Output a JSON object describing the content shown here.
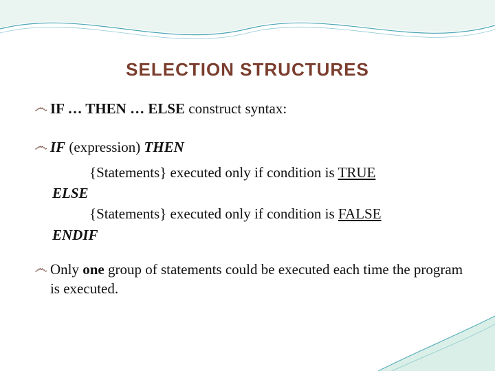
{
  "title": "SELECTION STRUCTURES",
  "line1": {
    "pre": "IF … THEN … ELSE",
    "rest": " construct syntax:"
  },
  "code": {
    "l1_a": "IF",
    "l1_b": " (expression) ",
    "l1_c": "THEN",
    "l2_a": "{Statements}  executed only if condition is ",
    "l2_true": "TRUE",
    "l3": "ELSE",
    "l4_a": "{Statements}  executed only if condition is ",
    "l4_false": "FALSE",
    "l5": "ENDIF"
  },
  "line3": {
    "pre": "Only ",
    "bold": "one",
    "rest": " group of statements could be executed each time the program is executed."
  },
  "bullet_glyph": "෴"
}
